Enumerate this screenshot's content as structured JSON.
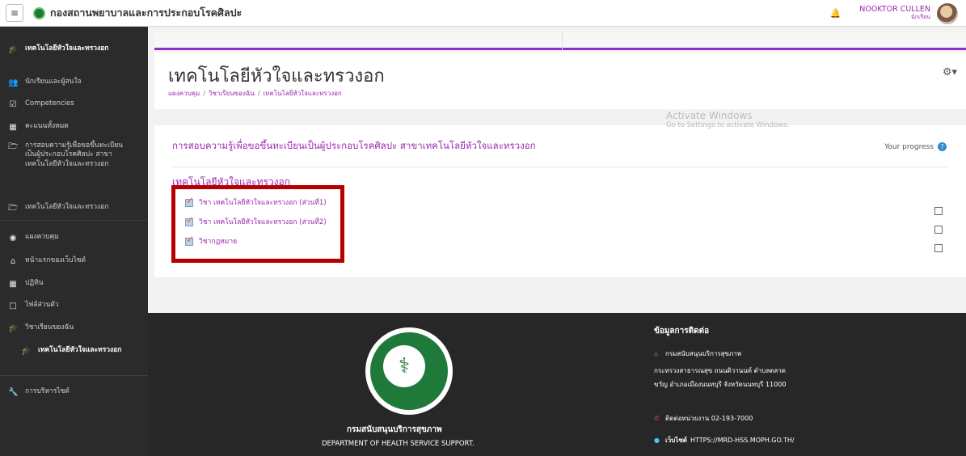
{
  "navbar": {
    "site_title": "กองสถานพยาบาลและการประกอบโรคศิลปะ",
    "user_name": "NOOKTOR CULLEN",
    "user_role": "นักเรียน",
    "hamburger_glyph": "≡",
    "bell_icon": "bell-icon"
  },
  "sidebar": {
    "items": [
      {
        "label": "เทคโนโลยีหัวใจและทรวงอก",
        "icon": "graduation-cap-icon"
      },
      {
        "label": "นักเรียนและผู้สนใจ",
        "icon": "users-icon"
      },
      {
        "label": "Competencies",
        "icon": "checkbox-icon"
      },
      {
        "label": "คะแนนทั้งหมด",
        "icon": "table-icon"
      },
      {
        "label": "การสอบความรู้เพื่อขอขึ้นทะเบียนเป็นผู้ประกอบโรคศิลปะ สาขาเทคโนโลยีหัวใจและทรวงอก",
        "icon": "folder-icon"
      },
      {
        "label": "เทคโนโลยีหัวใจและทรวงอก",
        "icon": "folder-icon"
      },
      {
        "label": "แผงควบคุม",
        "icon": "dashboard-icon"
      },
      {
        "label": "หน้าแรกของเว็บไซต์",
        "icon": "home-icon"
      },
      {
        "label": "ปฏิทิน",
        "icon": "calendar-icon"
      },
      {
        "label": "ไฟล์ส่วนตัว",
        "icon": "file-icon"
      },
      {
        "label": "วิชาเรียนของฉัน",
        "icon": "graduation-cap-icon"
      },
      {
        "label": "เทคโนโลยีหัวใจและทรวงอก",
        "icon": "graduation-cap-icon"
      },
      {
        "label": "การบริหารไซต์",
        "icon": "wrench-icon"
      }
    ]
  },
  "header": {
    "page_title": "เทคโนโลยีหัวใจและทรวงอก",
    "breadcrumb": [
      "แผงควบคุม",
      "วิชาเรียนของฉัน",
      "เทคโนโลยีหัวใจและทรวงอก"
    ],
    "breadcrumb_sep": "/",
    "gear_glyph": "⚙▾"
  },
  "course": {
    "section_title": "การสอบความรู้เพื่อขอขึ้นทะเบียนเป็นผู้ประกอบโรคศิลปะ สาขาเทคโนโลยีหัวใจและทรวงอก",
    "progress_label": "Your progress",
    "help_glyph": "?",
    "topic_title": "เทคโนโลยีหัวใจและทรวงอก",
    "activities": [
      {
        "label": "วิชา เทคโนโลยีหัวใจและทรวงอก (ส่วนที่1)",
        "completed": false
      },
      {
        "label": "วิชา เทคโนโลยีหัวใจและทรวงอก (ส่วนที่2)",
        "completed": false
      },
      {
        "label": "วิชากฎหมาย",
        "completed": false
      }
    ]
  },
  "footer": {
    "dept_th": "กรมสนับสนุนบริการสุขภาพ",
    "dept_en": "DEPARTMENT OF HEALTH SERVICE SUPPORT.",
    "contact_title": "ข้อมูลการติดต่อ",
    "contact_org": "กรมสนับสนุนบริการสุขภาพ",
    "address_1": "กระทรวงสาธารณสุข ถนนติวานนท์ ตำบลตลาด",
    "address_2": "ขวัญ อำเภอเมืองนนทบุรี จังหวัดนนทบุรี 11000",
    "phone": "ติดต่อหน่วยงาน 02-193-7000",
    "website_label": "เว็บไซต์",
    "website_url": "HTTPS://MRD-HSS.MOPH.GO.TH/"
  },
  "windows_notice": {
    "title": "Activate Windows",
    "subtitle": "Go to Settings to activate Windows."
  },
  "colors": {
    "accent": "#9c27b0",
    "sidebar_bg": "#2b2b2b",
    "footer_bg": "#272727",
    "highlight_box": "#b60000"
  }
}
